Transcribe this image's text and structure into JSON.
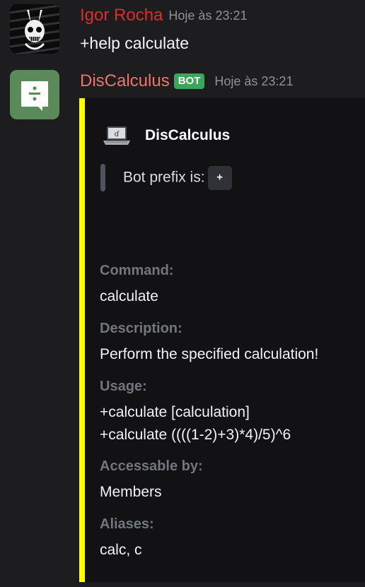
{
  "messages": [
    {
      "author": "Igor Rocha",
      "timestamp": "Hoje às 23:21",
      "content": "+help calculate",
      "avatar_icon": "skull-rabbit-icon",
      "author_color": "#e02b2b"
    },
    {
      "author": "DisCalculus",
      "tag": "BOT",
      "timestamp": "Hoje às 23:21",
      "avatar_icon": "division-icon",
      "author_color": "#f0736b"
    }
  ],
  "embed": {
    "accent_color": "#ffff00",
    "author_name": "DisCalculus",
    "author_icon": "laptop-icon",
    "quote_text": "Bot prefix is:",
    "prefix_code": "+",
    "fields": [
      {
        "name": "Command:",
        "value": "calculate"
      },
      {
        "name": "Description:",
        "value": "Perform the specified calculation!"
      },
      {
        "name": "Usage:",
        "value_lines": [
          "+calculate [calculation]",
          "+calculate ((((1-2)+3)*4)/5)^6"
        ]
      },
      {
        "name": "Accessable by:",
        "value": "Members"
      },
      {
        "name": "Aliases:",
        "value": "calc, c"
      }
    ]
  }
}
